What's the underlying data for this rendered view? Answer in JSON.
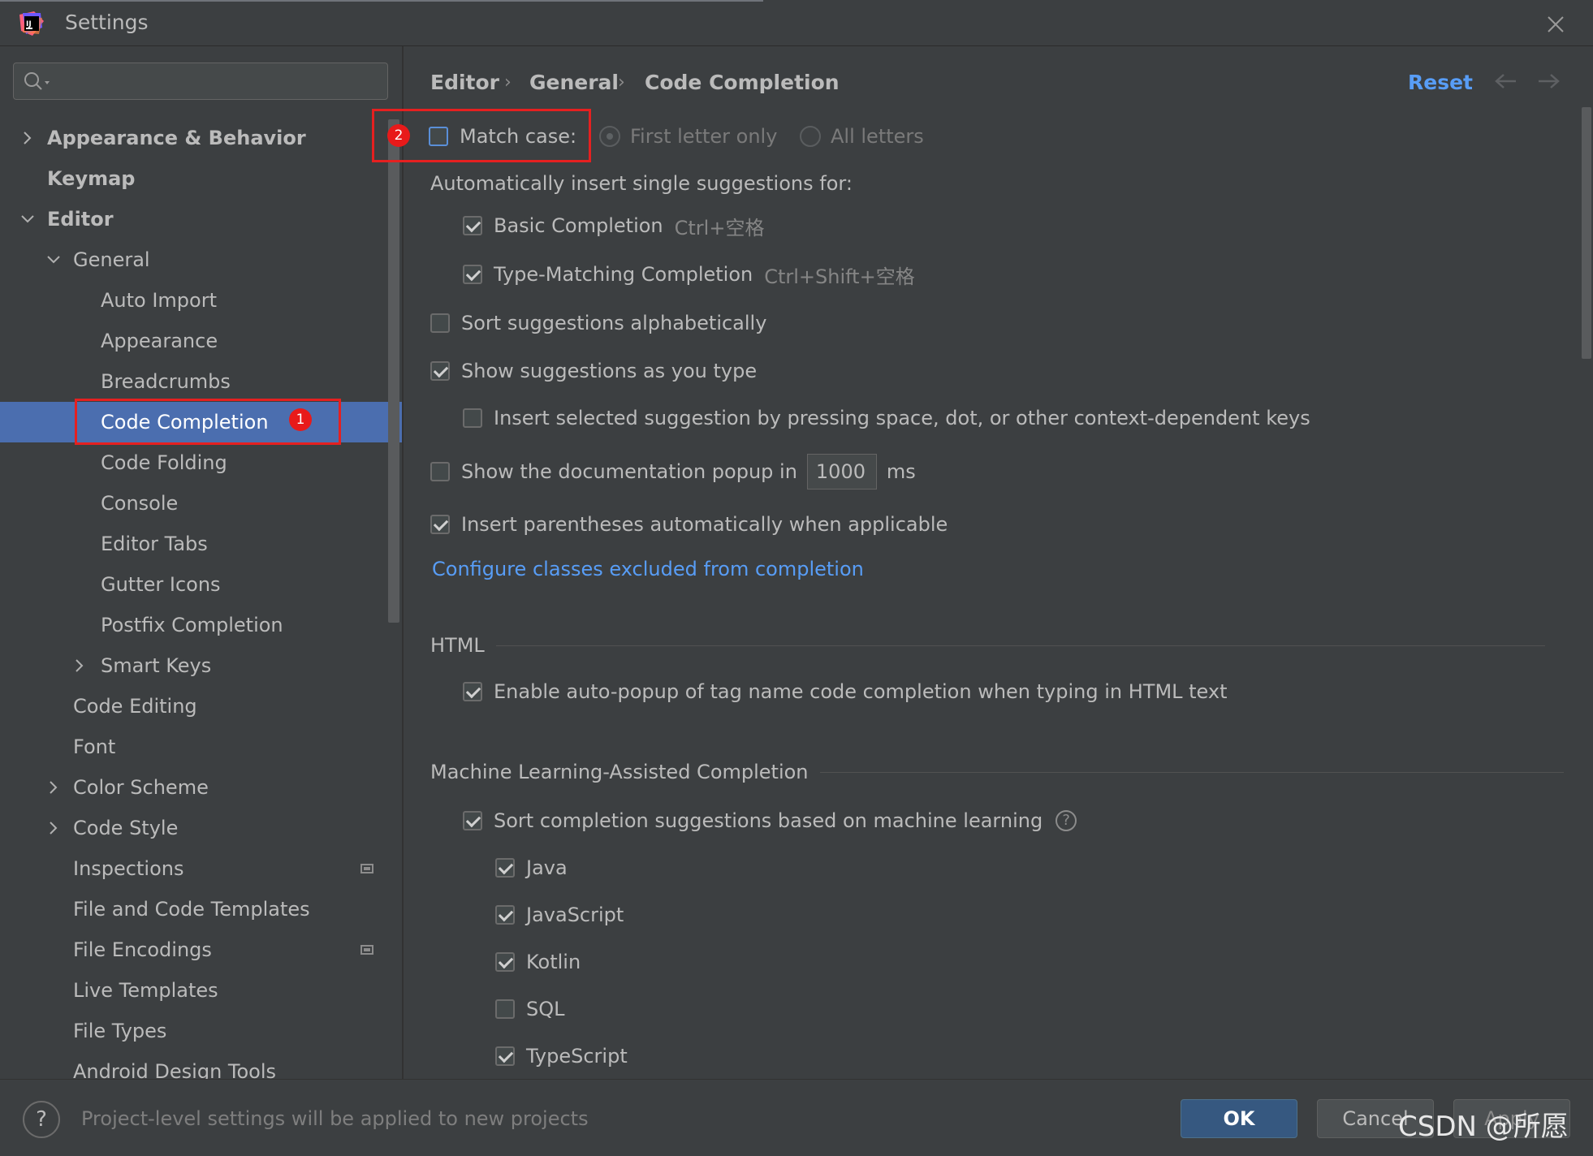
{
  "window": {
    "title": "Settings"
  },
  "search": {
    "placeholder": "",
    "value": ""
  },
  "sidebar": {
    "items": [
      {
        "label": "Appearance & Behavior",
        "expand": "collapsed"
      },
      {
        "label": "Keymap"
      },
      {
        "label": "Editor",
        "expand": "expanded"
      },
      {
        "label": "General",
        "expand": "expanded"
      },
      {
        "label": "Auto Import"
      },
      {
        "label": "Appearance"
      },
      {
        "label": "Breadcrumbs"
      },
      {
        "label": "Code Completion",
        "selected": true
      },
      {
        "label": "Code Folding"
      },
      {
        "label": "Console"
      },
      {
        "label": "Editor Tabs"
      },
      {
        "label": "Gutter Icons"
      },
      {
        "label": "Postfix Completion"
      },
      {
        "label": "Smart Keys",
        "expand": "collapsed"
      },
      {
        "label": "Code Editing"
      },
      {
        "label": "Font"
      },
      {
        "label": "Color Scheme",
        "expand": "collapsed"
      },
      {
        "label": "Code Style",
        "expand": "collapsed"
      },
      {
        "label": "Inspections",
        "project_icon": true
      },
      {
        "label": "File and Code Templates"
      },
      {
        "label": "File Encodings",
        "project_icon": true
      },
      {
        "label": "Live Templates"
      },
      {
        "label": "File Types"
      },
      {
        "label": "Android Design Tools"
      }
    ]
  },
  "breadcrumb": {
    "items": [
      "Editor",
      "General",
      "Code Completion"
    ],
    "separator": "›"
  },
  "header": {
    "reset": "Reset",
    "back_icon": "arrow-left-icon",
    "forward_icon": "arrow-right-icon"
  },
  "options": {
    "match_case": {
      "label": "Match case:",
      "checked": false
    },
    "first_letter": {
      "label": "First letter only",
      "selected": true
    },
    "all_letters": {
      "label": "All letters",
      "selected": false
    },
    "auto_insert_heading": "Automatically insert single suggestions for:",
    "basic": {
      "label": "Basic Completion",
      "shortcut": "Ctrl+空格",
      "checked": true
    },
    "type_matching": {
      "label": "Type-Matching Completion",
      "shortcut": "Ctrl+Shift+空格",
      "checked": true
    },
    "sort_alpha": {
      "label": "Sort suggestions alphabetically",
      "checked": false
    },
    "show_as_type": {
      "label": "Show suggestions as you type",
      "checked": true
    },
    "insert_selected": {
      "label": "Insert selected suggestion by pressing space, dot, or other context-dependent keys",
      "checked": false
    },
    "doc_popup": {
      "label": "Show the documentation popup in",
      "value": "1000",
      "unit": "ms",
      "checked": false
    },
    "parens": {
      "label": "Insert parentheses automatically when applicable",
      "checked": true
    },
    "configure_link": "Configure classes excluded from completion"
  },
  "html_section": {
    "title": "HTML",
    "auto_popup": {
      "label": "Enable auto-popup of tag name code completion when typing in HTML text",
      "checked": true
    }
  },
  "ml_section": {
    "title": "Machine Learning-Assisted Completion",
    "sort_ml": {
      "label": "Sort completion suggestions based on machine learning",
      "checked": true
    },
    "languages": [
      {
        "label": "Java",
        "checked": true
      },
      {
        "label": "JavaScript",
        "checked": true
      },
      {
        "label": "Kotlin",
        "checked": true
      },
      {
        "label": "SQL",
        "checked": false
      },
      {
        "label": "TypeScript",
        "checked": true
      }
    ]
  },
  "annotations": {
    "badge1": "1",
    "badge2": "2"
  },
  "footer": {
    "help": "?",
    "note": "Project-level settings will be applied to new projects",
    "ok": "OK",
    "cancel": "Cancel",
    "apply": "Apply",
    "watermark": "CSDN @所愿"
  },
  "colors": {
    "background": "#3c3f41",
    "selection": "#4b6eaf",
    "link": "#589df6",
    "annotation": "#e52020",
    "ok_button": "#365880"
  }
}
